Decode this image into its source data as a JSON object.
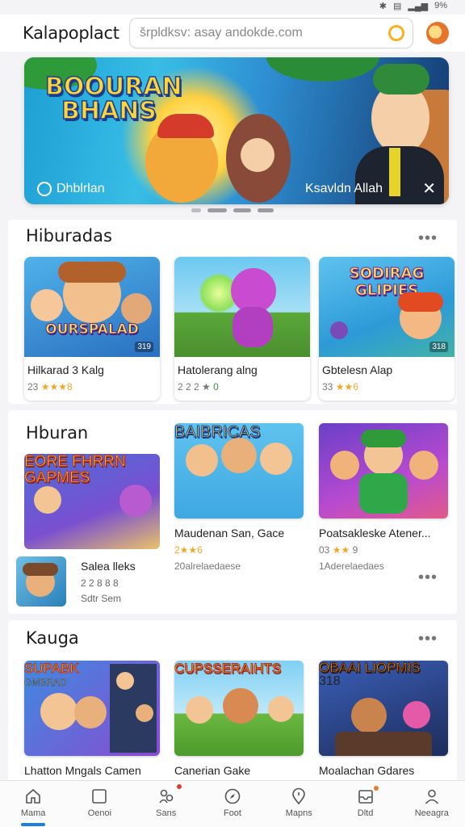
{
  "status": {
    "icons": [
      "bluetooth-icon",
      "vibrate-icon",
      "signal-icon"
    ],
    "battery": "9%"
  },
  "header": {
    "brand": "Kalapoplact",
    "search_value": "šrpldksv: asay andokde.com"
  },
  "banner": {
    "title_line1": "BOOURAN",
    "title_line2": "BHANS",
    "caption_left": "Dhblrlan",
    "caption_right": "Ksavldn Allah",
    "close_glyph": "✕",
    "slides": 4,
    "active_slide": 1
  },
  "section1": {
    "title": "Hiburadas",
    "more": "•••",
    "cards": [
      {
        "name": "Hilkarad 3 Kalg",
        "rating": "23",
        "stars": "★★★",
        "extra": "8",
        "tag": "319",
        "logo": "OURSPALAD"
      },
      {
        "name": "Hatolerang alng",
        "rating": "2 2 2 ★",
        "stars": "",
        "extra": "0",
        "tag": "",
        "logo": ""
      },
      {
        "name": "Gbtelesn Alap",
        "rating": "33",
        "stars": "★★",
        "extra": "6",
        "tag": "318",
        "logo": "SODIRAG GLIPIES"
      }
    ]
  },
  "section2": {
    "title": "Hburan",
    "more": "•••",
    "featured_logo": "EORE FHRRN GAPMES",
    "cards": [
      {
        "name": "Maudenan San, Gace",
        "rating": "2★★",
        "stars": "",
        "extra": "6",
        "sub": "20alrelaedaese",
        "logo": "BAIBRICAS"
      },
      {
        "name": "Poatsakleske Atener...",
        "rating": "03",
        "stars": "★★",
        "extra": "9",
        "sub": "1Aderelaedaes",
        "logo": ""
      }
    ],
    "small": {
      "title": "Salea lleks",
      "line1": "2 2 8 8 8",
      "line2": "Sdtr Sem"
    }
  },
  "section3": {
    "title": "Kauga",
    "more": "•••",
    "cards": [
      {
        "name": "Lhatton Mngals Camen",
        "logo": "SUPABK",
        "logo2": "GMBRAD",
        "tag": ""
      },
      {
        "name": "Canerian Gake",
        "logo": "CUPSSERAIHTS",
        "tag": ""
      },
      {
        "name": "Moalachan Gdares",
        "logo": "OBAAI LIOPMIS",
        "tag": "318"
      }
    ]
  },
  "tabs": [
    {
      "label": "Mama",
      "icon": "home-icon",
      "active": true
    },
    {
      "label": "Oenoi",
      "icon": "square-icon",
      "active": false
    },
    {
      "label": "Sans",
      "icon": "people-icon",
      "active": false
    },
    {
      "label": "Foot",
      "icon": "compass-icon",
      "active": false
    },
    {
      "label": "Mapns",
      "icon": "location-icon",
      "active": false
    },
    {
      "label": "Dltd",
      "icon": "inbox-icon",
      "active": false
    },
    {
      "label": "Neeagra",
      "icon": "profile-icon",
      "active": false
    }
  ],
  "colors": {
    "accent": "#1c7fd9",
    "star": "#f0a72a",
    "search_icon": "#f5b21c"
  }
}
